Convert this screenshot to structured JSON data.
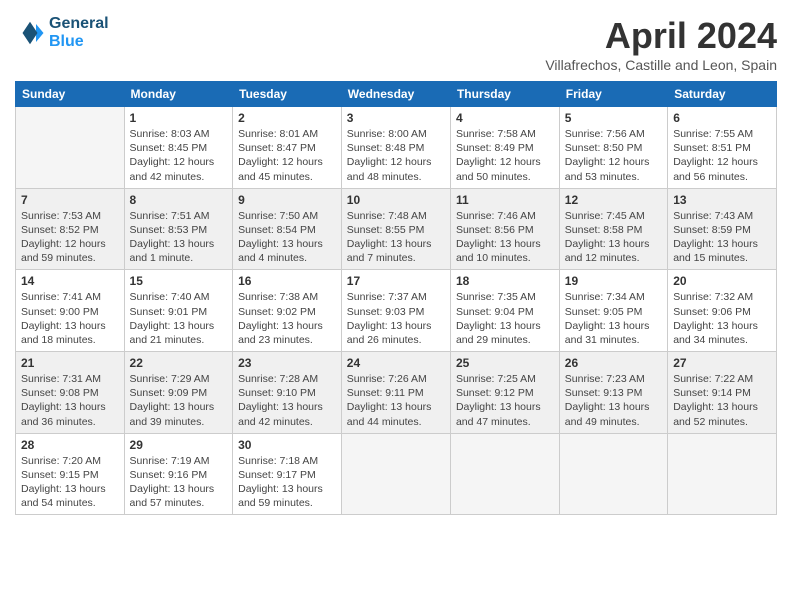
{
  "logo": {
    "line1": "General",
    "line2": "Blue"
  },
  "title": "April 2024",
  "location": "Villafrechos, Castille and Leon, Spain",
  "weekdays": [
    "Sunday",
    "Monday",
    "Tuesday",
    "Wednesday",
    "Thursday",
    "Friday",
    "Saturday"
  ],
  "weeks": [
    [
      {
        "num": "",
        "sunrise": "",
        "sunset": "",
        "daylight": ""
      },
      {
        "num": "1",
        "sunrise": "Sunrise: 8:03 AM",
        "sunset": "Sunset: 8:45 PM",
        "daylight": "Daylight: 12 hours and 42 minutes."
      },
      {
        "num": "2",
        "sunrise": "Sunrise: 8:01 AM",
        "sunset": "Sunset: 8:47 PM",
        "daylight": "Daylight: 12 hours and 45 minutes."
      },
      {
        "num": "3",
        "sunrise": "Sunrise: 8:00 AM",
        "sunset": "Sunset: 8:48 PM",
        "daylight": "Daylight: 12 hours and 48 minutes."
      },
      {
        "num": "4",
        "sunrise": "Sunrise: 7:58 AM",
        "sunset": "Sunset: 8:49 PM",
        "daylight": "Daylight: 12 hours and 50 minutes."
      },
      {
        "num": "5",
        "sunrise": "Sunrise: 7:56 AM",
        "sunset": "Sunset: 8:50 PM",
        "daylight": "Daylight: 12 hours and 53 minutes."
      },
      {
        "num": "6",
        "sunrise": "Sunrise: 7:55 AM",
        "sunset": "Sunset: 8:51 PM",
        "daylight": "Daylight: 12 hours and 56 minutes."
      }
    ],
    [
      {
        "num": "7",
        "sunrise": "Sunrise: 7:53 AM",
        "sunset": "Sunset: 8:52 PM",
        "daylight": "Daylight: 12 hours and 59 minutes."
      },
      {
        "num": "8",
        "sunrise": "Sunrise: 7:51 AM",
        "sunset": "Sunset: 8:53 PM",
        "daylight": "Daylight: 13 hours and 1 minute."
      },
      {
        "num": "9",
        "sunrise": "Sunrise: 7:50 AM",
        "sunset": "Sunset: 8:54 PM",
        "daylight": "Daylight: 13 hours and 4 minutes."
      },
      {
        "num": "10",
        "sunrise": "Sunrise: 7:48 AM",
        "sunset": "Sunset: 8:55 PM",
        "daylight": "Daylight: 13 hours and 7 minutes."
      },
      {
        "num": "11",
        "sunrise": "Sunrise: 7:46 AM",
        "sunset": "Sunset: 8:56 PM",
        "daylight": "Daylight: 13 hours and 10 minutes."
      },
      {
        "num": "12",
        "sunrise": "Sunrise: 7:45 AM",
        "sunset": "Sunset: 8:58 PM",
        "daylight": "Daylight: 13 hours and 12 minutes."
      },
      {
        "num": "13",
        "sunrise": "Sunrise: 7:43 AM",
        "sunset": "Sunset: 8:59 PM",
        "daylight": "Daylight: 13 hours and 15 minutes."
      }
    ],
    [
      {
        "num": "14",
        "sunrise": "Sunrise: 7:41 AM",
        "sunset": "Sunset: 9:00 PM",
        "daylight": "Daylight: 13 hours and 18 minutes."
      },
      {
        "num": "15",
        "sunrise": "Sunrise: 7:40 AM",
        "sunset": "Sunset: 9:01 PM",
        "daylight": "Daylight: 13 hours and 21 minutes."
      },
      {
        "num": "16",
        "sunrise": "Sunrise: 7:38 AM",
        "sunset": "Sunset: 9:02 PM",
        "daylight": "Daylight: 13 hours and 23 minutes."
      },
      {
        "num": "17",
        "sunrise": "Sunrise: 7:37 AM",
        "sunset": "Sunset: 9:03 PM",
        "daylight": "Daylight: 13 hours and 26 minutes."
      },
      {
        "num": "18",
        "sunrise": "Sunrise: 7:35 AM",
        "sunset": "Sunset: 9:04 PM",
        "daylight": "Daylight: 13 hours and 29 minutes."
      },
      {
        "num": "19",
        "sunrise": "Sunrise: 7:34 AM",
        "sunset": "Sunset: 9:05 PM",
        "daylight": "Daylight: 13 hours and 31 minutes."
      },
      {
        "num": "20",
        "sunrise": "Sunrise: 7:32 AM",
        "sunset": "Sunset: 9:06 PM",
        "daylight": "Daylight: 13 hours and 34 minutes."
      }
    ],
    [
      {
        "num": "21",
        "sunrise": "Sunrise: 7:31 AM",
        "sunset": "Sunset: 9:08 PM",
        "daylight": "Daylight: 13 hours and 36 minutes."
      },
      {
        "num": "22",
        "sunrise": "Sunrise: 7:29 AM",
        "sunset": "Sunset: 9:09 PM",
        "daylight": "Daylight: 13 hours and 39 minutes."
      },
      {
        "num": "23",
        "sunrise": "Sunrise: 7:28 AM",
        "sunset": "Sunset: 9:10 PM",
        "daylight": "Daylight: 13 hours and 42 minutes."
      },
      {
        "num": "24",
        "sunrise": "Sunrise: 7:26 AM",
        "sunset": "Sunset: 9:11 PM",
        "daylight": "Daylight: 13 hours and 44 minutes."
      },
      {
        "num": "25",
        "sunrise": "Sunrise: 7:25 AM",
        "sunset": "Sunset: 9:12 PM",
        "daylight": "Daylight: 13 hours and 47 minutes."
      },
      {
        "num": "26",
        "sunrise": "Sunrise: 7:23 AM",
        "sunset": "Sunset: 9:13 PM",
        "daylight": "Daylight: 13 hours and 49 minutes."
      },
      {
        "num": "27",
        "sunrise": "Sunrise: 7:22 AM",
        "sunset": "Sunset: 9:14 PM",
        "daylight": "Daylight: 13 hours and 52 minutes."
      }
    ],
    [
      {
        "num": "28",
        "sunrise": "Sunrise: 7:20 AM",
        "sunset": "Sunset: 9:15 PM",
        "daylight": "Daylight: 13 hours and 54 minutes."
      },
      {
        "num": "29",
        "sunrise": "Sunrise: 7:19 AM",
        "sunset": "Sunset: 9:16 PM",
        "daylight": "Daylight: 13 hours and 57 minutes."
      },
      {
        "num": "30",
        "sunrise": "Sunrise: 7:18 AM",
        "sunset": "Sunset: 9:17 PM",
        "daylight": "Daylight: 13 hours and 59 minutes."
      },
      {
        "num": "",
        "sunrise": "",
        "sunset": "",
        "daylight": ""
      },
      {
        "num": "",
        "sunrise": "",
        "sunset": "",
        "daylight": ""
      },
      {
        "num": "",
        "sunrise": "",
        "sunset": "",
        "daylight": ""
      },
      {
        "num": "",
        "sunrise": "",
        "sunset": "",
        "daylight": ""
      }
    ]
  ]
}
